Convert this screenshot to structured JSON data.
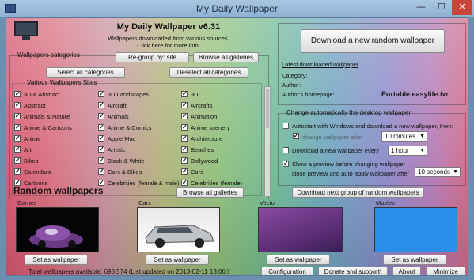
{
  "window": {
    "title": "My Daily Wallpaper"
  },
  "header": {
    "app_title": "My Daily Wallpaper v6.31",
    "subtitle_line1": "Wallpapers downloaded from various sources.",
    "subtitle_line2": "Click here for more info."
  },
  "categories": {
    "legend": "Wallpapers categories",
    "regroup_label": "Re-group by: site",
    "browse_all_label": "Browse all galleries",
    "select_all_label": "Select all categories",
    "deselect_all_label": "Deselect all categories",
    "group_legend": "Various Wallpapers Sites",
    "columns": [
      [
        "3D & Abstract",
        "Abstract",
        "Animals & Nature",
        "Anime & Cartoons",
        "Anime",
        "Art",
        "Bikes",
        "Calendars",
        "Cartoons"
      ],
      [
        "3D Landscapes",
        "Aircraft",
        "Animals",
        "Anime & Comics",
        "Apple Mac",
        "Artistic",
        "Black & White",
        "Cars & Bikes",
        "Celebrities (female & male)"
      ],
      [
        "3D",
        "Aircrafts",
        "Animation",
        "Anime scenery",
        "Architecture",
        "Beaches",
        "Bollywood",
        "Cars",
        "Celebrities (female)"
      ]
    ]
  },
  "download": {
    "button_label": "Download a new random wallpaper",
    "latest_link": "Latest downloaded wallpaper",
    "category_label": "Category:",
    "author_label": "Author:",
    "homepage_label": "Author's homepage:"
  },
  "watermark": {
    "text": "Portable.easylife.tw"
  },
  "auto_change": {
    "legend": "Change automatically the desktop wallpaper",
    "autostart_label": "Autostart with Windows and download a new wallpaper, then:",
    "change_after_label": "change wallpaper after",
    "change_after_value": "10 minutes",
    "download_every_label": "Download a new wallpaper every",
    "download_every_value": "1 hour",
    "preview_label_line1": "Show a preview before changing wallpaper",
    "preview_label_line2": "close preview and auto apply wallpaper after",
    "preview_value": "10 seconds"
  },
  "random": {
    "title": "Random wallpapers",
    "browse_all_label": "Browse all galleries",
    "download_next_label": "Download next group of random wallpapers",
    "items": [
      {
        "caption": "Games",
        "button": "Set as wallpaper"
      },
      {
        "caption": "Cars",
        "button": "Set as wallpaper"
      },
      {
        "caption": "Vector",
        "button": "Set as wallpaper"
      },
      {
        "caption": "Movies",
        "button": "Set as wallpaper"
      }
    ]
  },
  "status": {
    "text": "Total wallpapers available: 693,574 (List updated on 2013-02-11 13:06 )",
    "configuration_label": "Configuration",
    "donate_label": "Donate and support!",
    "about_label": "About",
    "minimize_label": "Minimize"
  },
  "colors": {
    "close_button": "#c9453a",
    "movies_thumb": "#2a8ee8",
    "vector_thumb": "#7a3f8e"
  }
}
